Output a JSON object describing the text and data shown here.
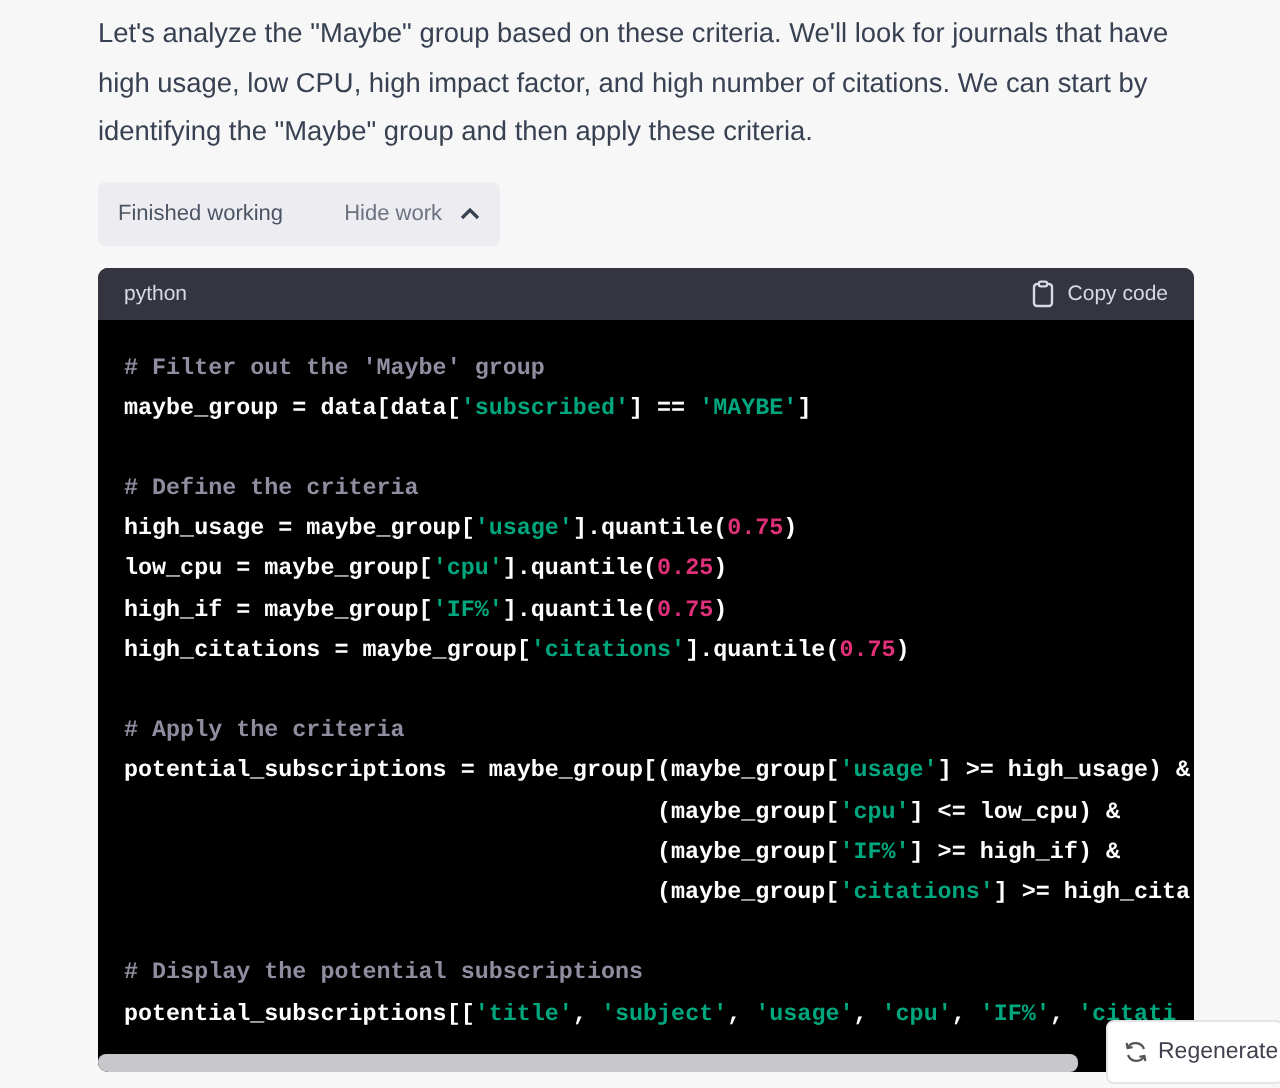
{
  "message": {
    "text": "Let's analyze the \"Maybe\" group based on these criteria. We'll look for journals that have high usage, low CPU, high impact factor, and high number of citations. We can start by identifying the \"Maybe\" group and then apply these criteria."
  },
  "work_status": {
    "label": "Finished working",
    "toggle": "Hide work"
  },
  "code_block": {
    "language": "python",
    "copy_label": "Copy code",
    "lines": [
      {
        "tokens": [
          {
            "kind": "comment",
            "text": "# Filter out the 'Maybe' group"
          }
        ]
      },
      {
        "tokens": [
          {
            "kind": "plain",
            "text": "maybe_group = data[data["
          },
          {
            "kind": "string",
            "text": "'subscribed'"
          },
          {
            "kind": "plain",
            "text": "] == "
          },
          {
            "kind": "string",
            "text": "'MAYBE'"
          },
          {
            "kind": "plain",
            "text": "]"
          }
        ]
      },
      {
        "kind": "blank"
      },
      {
        "tokens": [
          {
            "kind": "comment",
            "text": "# Define the criteria"
          }
        ]
      },
      {
        "tokens": [
          {
            "kind": "plain",
            "text": "high_usage = maybe_group["
          },
          {
            "kind": "string",
            "text": "'usage'"
          },
          {
            "kind": "plain",
            "text": "].quantile("
          },
          {
            "kind": "number",
            "text": "0.75"
          },
          {
            "kind": "plain",
            "text": ")"
          }
        ]
      },
      {
        "tokens": [
          {
            "kind": "plain",
            "text": "low_cpu = maybe_group["
          },
          {
            "kind": "string",
            "text": "'cpu'"
          },
          {
            "kind": "plain",
            "text": "].quantile("
          },
          {
            "kind": "number",
            "text": "0.25"
          },
          {
            "kind": "plain",
            "text": ")"
          }
        ]
      },
      {
        "tokens": [
          {
            "kind": "plain",
            "text": "high_if = maybe_group["
          },
          {
            "kind": "string",
            "text": "'IF%'"
          },
          {
            "kind": "plain",
            "text": "].quantile("
          },
          {
            "kind": "number",
            "text": "0.75"
          },
          {
            "kind": "plain",
            "text": ")"
          }
        ]
      },
      {
        "tokens": [
          {
            "kind": "plain",
            "text": "high_citations = maybe_group["
          },
          {
            "kind": "string",
            "text": "'citations'"
          },
          {
            "kind": "plain",
            "text": "].quantile("
          },
          {
            "kind": "number",
            "text": "0.75"
          },
          {
            "kind": "plain",
            "text": ")"
          }
        ]
      },
      {
        "kind": "blank"
      },
      {
        "tokens": [
          {
            "kind": "comment",
            "text": "# Apply the criteria"
          }
        ]
      },
      {
        "tokens": [
          {
            "kind": "plain",
            "text": "potential_subscriptions = maybe_group[(maybe_group["
          },
          {
            "kind": "string",
            "text": "'usage'"
          },
          {
            "kind": "plain",
            "text": "] >= high_usage) &"
          }
        ]
      },
      {
        "tokens": [
          {
            "kind": "plain",
            "text": "                                      (maybe_group["
          },
          {
            "kind": "string",
            "text": "'cpu'"
          },
          {
            "kind": "plain",
            "text": "] <= low_cpu) &"
          }
        ]
      },
      {
        "tokens": [
          {
            "kind": "plain",
            "text": "                                      (maybe_group["
          },
          {
            "kind": "string",
            "text": "'IF%'"
          },
          {
            "kind": "plain",
            "text": "] >= high_if) &"
          }
        ]
      },
      {
        "tokens": [
          {
            "kind": "plain",
            "text": "                                      (maybe_group["
          },
          {
            "kind": "string",
            "text": "'citations'"
          },
          {
            "kind": "plain",
            "text": "] >= high_cita"
          }
        ]
      },
      {
        "kind": "blank"
      },
      {
        "tokens": [
          {
            "kind": "comment",
            "text": "# Display the potential subscriptions"
          }
        ]
      },
      {
        "tokens": [
          {
            "kind": "plain",
            "text": "potential_subscriptions[["
          },
          {
            "kind": "string",
            "text": "'title'"
          },
          {
            "kind": "plain",
            "text": ", "
          },
          {
            "kind": "string",
            "text": "'subject'"
          },
          {
            "kind": "plain",
            "text": ", "
          },
          {
            "kind": "string",
            "text": "'usage'"
          },
          {
            "kind": "plain",
            "text": ", "
          },
          {
            "kind": "string",
            "text": "'cpu'"
          },
          {
            "kind": "plain",
            "text": ", "
          },
          {
            "kind": "string",
            "text": "'IF%'"
          },
          {
            "kind": "plain",
            "text": ", "
          },
          {
            "kind": "string",
            "text": "'citati"
          }
        ]
      }
    ]
  },
  "regenerate_button": {
    "label": "Regenerate"
  }
}
